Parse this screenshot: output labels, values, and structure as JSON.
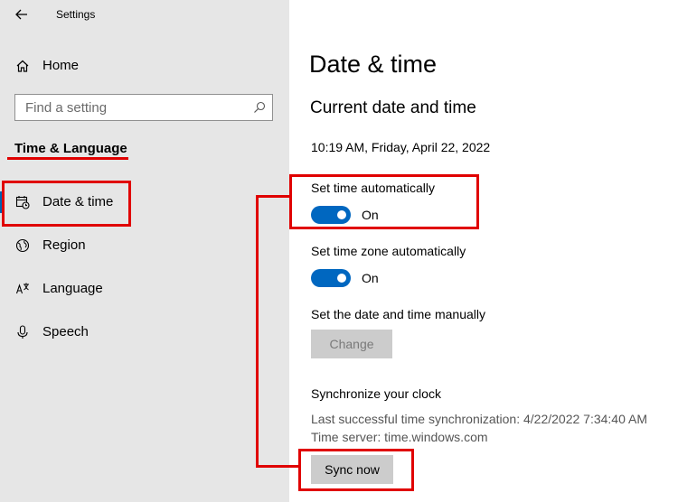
{
  "window": {
    "title": "Settings"
  },
  "sidebar": {
    "home_label": "Home",
    "search_placeholder": "Find a setting",
    "section_title": "Time & Language",
    "items": [
      {
        "label": "Date & time",
        "icon": "calendar-clock-icon",
        "active": true
      },
      {
        "label": "Region",
        "icon": "globe-icon"
      },
      {
        "label": "Language",
        "icon": "language-icon"
      },
      {
        "label": "Speech",
        "icon": "microphone-icon"
      }
    ]
  },
  "main": {
    "page_title": "Date & time",
    "section_title": "Current date and time",
    "current_datetime": "10:19 AM, Friday, April 22, 2022",
    "set_time_auto": {
      "label": "Set time automatically",
      "state": "On",
      "enabled": true
    },
    "set_timezone_auto": {
      "label": "Set time zone automatically",
      "state": "On",
      "enabled": true
    },
    "manual": {
      "label": "Set the date and time manually",
      "button": "Change"
    },
    "sync": {
      "title": "Synchronize your clock",
      "last_sync": "Last successful time synchronization: 4/22/2022 7:34:40 AM",
      "server": "Time server: time.windows.com",
      "button": "Sync now"
    }
  },
  "colors": {
    "accent": "#0067c0",
    "annotation": "#e00000",
    "sidebar_bg": "#e6e6e6"
  }
}
